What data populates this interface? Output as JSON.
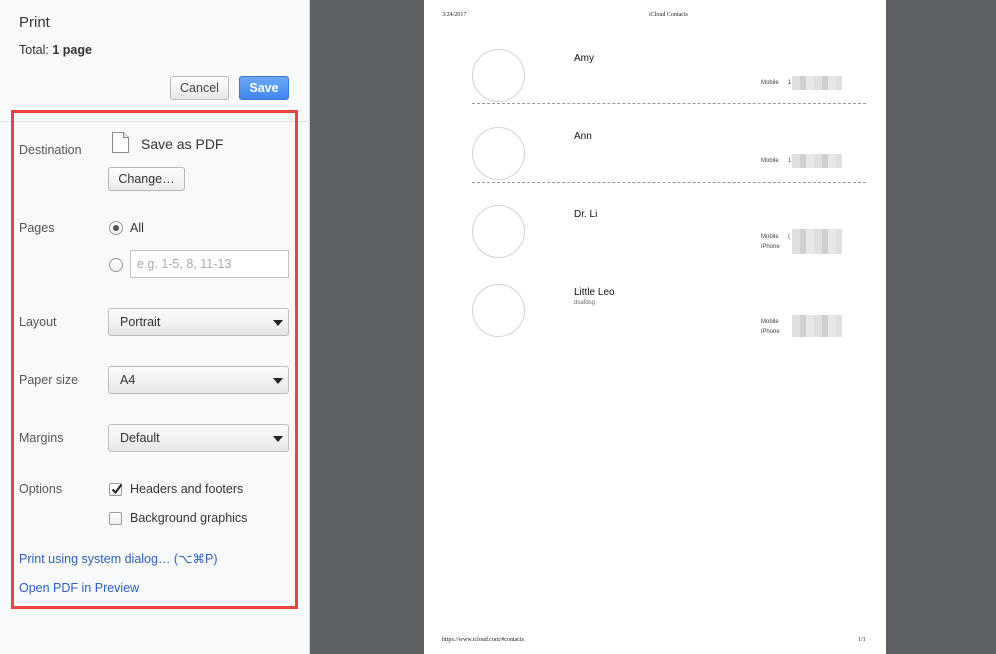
{
  "dialog": {
    "title": "Print",
    "total_label": "Total:",
    "total_value": "1 page",
    "cancel_label": "Cancel",
    "save_label": "Save"
  },
  "settings": {
    "destination_label": "Destination",
    "destination_value": "Save as PDF",
    "change_label": "Change…",
    "pages_label": "Pages",
    "pages_all_label": "All",
    "pages_custom_placeholder": "e.g. 1-5, 8, 11-13",
    "layout_label": "Layout",
    "layout_value": "Portrait",
    "paper_size_label": "Paper size",
    "paper_size_value": "A4",
    "margins_label": "Margins",
    "margins_value": "Default",
    "options_label": "Options",
    "headers_footers_label": "Headers and footers",
    "headers_footers_checked": true,
    "background_graphics_label": "Background graphics",
    "background_graphics_checked": false,
    "system_dialog_link": "Print using system dialog… (⌥⌘P)",
    "open_pdf_link": "Open PDF in Preview"
  },
  "preview": {
    "header_date": "3/24/2017",
    "header_title": "iCloud Contacts",
    "footer_url": "https://www.icloud.com/#contacts",
    "footer_page": "1/1",
    "contacts": [
      {
        "name": "Amy",
        "subtitle": "",
        "labels": [
          "Mobile"
        ],
        "prefix": "1"
      },
      {
        "name": "Ann",
        "subtitle": "",
        "labels": [
          "Mobile"
        ],
        "prefix": "1"
      },
      {
        "name": "Dr. Li",
        "subtitle": "",
        "labels": [
          "Mobile",
          "iPhone"
        ],
        "prefix": "("
      },
      {
        "name": "Little Leo",
        "subtitle": "dsafdsg",
        "labels": [
          "Mobile",
          "iPhone"
        ],
        "prefix": ""
      }
    ]
  },
  "colors": {
    "accent_blue": "#4285f4",
    "highlight_red": "#e8453c",
    "link_blue": "#2f5fbf",
    "preview_background": "#5f6264"
  }
}
